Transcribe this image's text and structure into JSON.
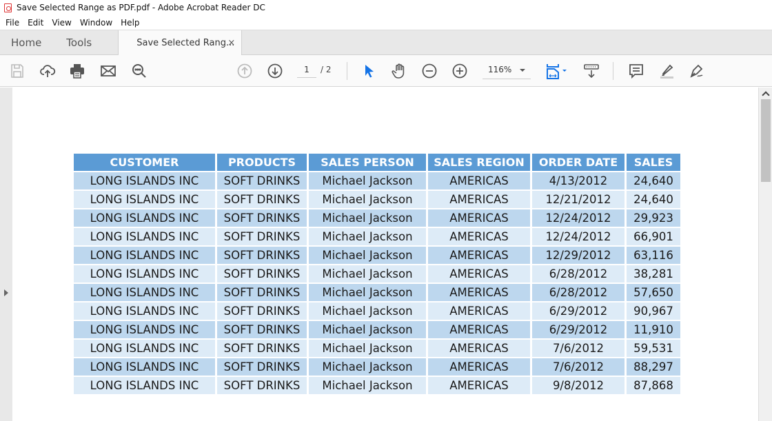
{
  "window": {
    "title": "Save Selected Range as PDF.pdf - Adobe Acrobat Reader DC"
  },
  "menu": [
    "File",
    "Edit",
    "View",
    "Window",
    "Help"
  ],
  "tabs": {
    "home": "Home",
    "tools": "Tools",
    "document": "Save Selected Rang...",
    "close": "×"
  },
  "toolbar": {
    "icons": [
      "save-icon",
      "upload-cloud-icon",
      "print-icon",
      "email-icon",
      "search-icon",
      "page-up-icon",
      "page-down-icon",
      "select-pointer-icon",
      "hand-icon",
      "zoom-out-icon",
      "zoom-in-icon",
      "page-fit-icon",
      "scroll-mode-icon",
      "comment-icon",
      "highlight-icon",
      "sign-icon"
    ],
    "current_page": "1",
    "total_pages": "/ 2",
    "zoom": "116%",
    "accent": "#1473e6"
  },
  "table": {
    "headers": [
      "CUSTOMER",
      "PRODUCTS",
      "SALES PERSON",
      "SALES REGION",
      "ORDER DATE",
      "SALES"
    ],
    "header_color": "#5b9bd5",
    "row_colors": [
      "#bdd7ee",
      "#ddebf7"
    ],
    "rows": [
      [
        "LONG ISLANDS INC",
        "SOFT DRINKS",
        "Michael Jackson",
        "AMERICAS",
        "4/13/2012",
        "24,640"
      ],
      [
        "LONG ISLANDS INC",
        "SOFT DRINKS",
        "Michael Jackson",
        "AMERICAS",
        "12/21/2012",
        "24,640"
      ],
      [
        "LONG ISLANDS INC",
        "SOFT DRINKS",
        "Michael Jackson",
        "AMERICAS",
        "12/24/2012",
        "29,923"
      ],
      [
        "LONG ISLANDS INC",
        "SOFT DRINKS",
        "Michael Jackson",
        "AMERICAS",
        "12/24/2012",
        "66,901"
      ],
      [
        "LONG ISLANDS INC",
        "SOFT DRINKS",
        "Michael Jackson",
        "AMERICAS",
        "12/29/2012",
        "63,116"
      ],
      [
        "LONG ISLANDS INC",
        "SOFT DRINKS",
        "Michael Jackson",
        "AMERICAS",
        "6/28/2012",
        "38,281"
      ],
      [
        "LONG ISLANDS INC",
        "SOFT DRINKS",
        "Michael Jackson",
        "AMERICAS",
        "6/28/2012",
        "57,650"
      ],
      [
        "LONG ISLANDS INC",
        "SOFT DRINKS",
        "Michael Jackson",
        "AMERICAS",
        "6/29/2012",
        "90,967"
      ],
      [
        "LONG ISLANDS INC",
        "SOFT DRINKS",
        "Michael Jackson",
        "AMERICAS",
        "6/29/2012",
        "11,910"
      ],
      [
        "LONG ISLANDS INC",
        "SOFT DRINKS",
        "Michael Jackson",
        "AMERICAS",
        "7/6/2012",
        "59,531"
      ],
      [
        "LONG ISLANDS INC",
        "SOFT DRINKS",
        "Michael Jackson",
        "AMERICAS",
        "7/6/2012",
        "88,297"
      ],
      [
        "LONG ISLANDS INC",
        "SOFT DRINKS",
        "Michael Jackson",
        "AMERICAS",
        "9/8/2012",
        "87,868"
      ]
    ]
  }
}
